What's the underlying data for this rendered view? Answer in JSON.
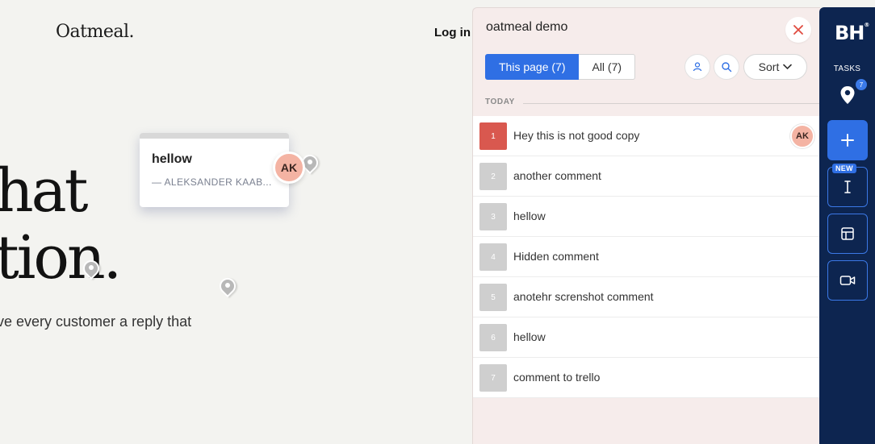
{
  "site": {
    "logo": "Oatmeal.",
    "login": "Log in",
    "hero_line1": "hat",
    "hero_line2": "tion.",
    "subline": "ve every customer a reply that"
  },
  "card": {
    "title": "hellow",
    "author": "— ALEKSANDER KAAB...",
    "avatar": "AK"
  },
  "panel": {
    "title": "oatmeal demo",
    "tabs": [
      {
        "label": "This page (7)",
        "active": true
      },
      {
        "label": "All (7)",
        "active": false
      }
    ],
    "sort_label": "Sort",
    "group_label": "TODAY",
    "comments": [
      {
        "number": "1",
        "text": "Hey this is not good copy",
        "avatar": "AK",
        "color": "#d9584f"
      },
      {
        "number": "2",
        "text": "another comment"
      },
      {
        "number": "3",
        "text": "hellow"
      },
      {
        "number": "4",
        "text": "Hidden comment"
      },
      {
        "number": "5",
        "text": "anotehr screnshot comment"
      },
      {
        "number": "6",
        "text": "hellow"
      },
      {
        "number": "7",
        "text": "comment to trello"
      }
    ]
  },
  "rail": {
    "logo": "BH",
    "logo_mark": "®",
    "tasks_label": "TASKS",
    "tasks_count": "7",
    "new_badge": "NEW"
  },
  "colors": {
    "accent": "#2f6fe4",
    "rail_bg": "#0d2550",
    "panel_bg": "#f6eceb",
    "close_red": "#e04b3f"
  },
  "icons": [
    "close-icon",
    "user-icon",
    "search-icon",
    "chevron-down-icon",
    "map-pin-icon",
    "plus-icon",
    "text-cursor-icon",
    "layout-icon",
    "video-icon"
  ]
}
